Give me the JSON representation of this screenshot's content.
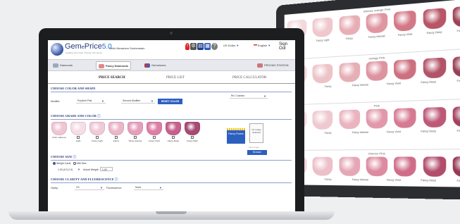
{
  "monitor": {
    "rows": [
      {
        "title": "Intense orange Pink",
        "labels": [
          "Light",
          "Fancy Light",
          "Fancy",
          "Fancy Intense",
          "Fancy Vivid",
          "Fancy Deep",
          "Fancy Dark"
        ],
        "colors": [
          "#f3d9dc",
          "#efc7cc",
          "#e8aeb6",
          "#df96a1",
          "#d37886",
          "#b85567",
          "#9e4254"
        ]
      },
      {
        "title": "orangy Pink",
        "labels": [
          "Fancy Light",
          "Fancy",
          "Fancy Intense",
          "Fancy Vivid",
          "Fancy Deep",
          "Fancy Dark"
        ],
        "colors": [
          "#f1d6d8",
          "#ecc3c7",
          "#e6aeb5",
          "#dd93a0",
          "#cc7080",
          "#b25368",
          "#993f55"
        ]
      },
      {
        "title": "Pink",
        "labels": [
          "Fancy Light",
          "Fancy",
          "Fancy Intense",
          "Fancy Vivid",
          "Fancy Deep",
          "Fancy Dark"
        ],
        "colors": [
          "#f4dbe0",
          "#efc9d0",
          "#e9b3bf",
          "#e198aa",
          "#d67a92",
          "#bd5876",
          "#a3425f"
        ]
      },
      {
        "title": "Intense Pink",
        "labels": [
          "Fancy Light",
          "Fancy",
          "Fancy Intense",
          "Fancy Vivid",
          "Fancy Deep",
          "Fancy Dark"
        ],
        "colors": [
          "#f2d4da",
          "#ecbfc9",
          "#e5a7b6",
          "#dc8ba0",
          "#cf6d89",
          "#b24d6c",
          "#963954"
        ]
      }
    ]
  },
  "header": {
    "logo_text": "Gem",
    "logo_e": "e",
    "logo_price": "Price",
    "logo_version": "5.0",
    "tagline": "Grading Your Color, Pricing Your Gems",
    "hello": "Hello Menahem Sonberstain",
    "currency": "US Dollar",
    "language": "English",
    "sign_out": "Sign Out"
  },
  "subnav": {
    "tabs": [
      "Diamonds",
      "Fancy Diamonds",
      "Gemstones"
    ],
    "pricing_station": "PRICING STATION"
  },
  "main_tabs": [
    "PRICE SEARCH",
    "PRICE LIST",
    "PRICE CALCULATOR"
  ],
  "sections": {
    "color_shape": "CHOOSE COLOR AND SHAPE",
    "grade_color": "CHOOSE GRADE AND COLOR",
    "size": "CHOOSE SIZE",
    "clarity": "CHOOSE CLARITY AND FLUORESCENCE"
  },
  "color_shape": {
    "modifier_label": "Modifier:",
    "primary": "Purplish Pink",
    "secondary": "Second Modifier",
    "reset": "RESET COLOR",
    "shape": "Rd. Cushion"
  },
  "grade_color": {
    "items": [
      {
        "label": "Color make-up",
        "color": "#f0c6d4"
      },
      {
        "label": "Light",
        "color": "#f6dde6"
      },
      {
        "label": "Fancy Light",
        "color": "#f1c9d8"
      },
      {
        "label": "Fancy",
        "color": "#ecb6ca"
      },
      {
        "label": "Fancy Intense",
        "color": "#e69fbb"
      },
      {
        "label": "Fancy Vivid",
        "color": "#dd7ea5"
      },
      {
        "label": "Fancy Deep",
        "color": "#c6608c"
      },
      {
        "label": "Fancy Dark",
        "color": "#a84a74"
      }
    ],
    "fancy_rulers": "Fancy Rulers",
    "no_image": "No Image Selected",
    "find_image": "Find Image",
    "browse": "Browse"
  },
  "size": {
    "option_weight": "Weight Carat",
    "option_mm": "MM Size",
    "range": "1.00  (0.5-2.9)",
    "actual_label": "Actual Weight:",
    "actual_value": "1.00"
  },
  "clarity": {
    "clarity_label": "Clarity:",
    "clarity_value": "VS",
    "fluor_label": "Fluorescence:",
    "fluor_value": "None"
  },
  "colors": {
    "accent_blue": "#2d5fc0",
    "laptop_bezel": "#1c1d1f",
    "monitor_bezel": "#2b2d31"
  }
}
